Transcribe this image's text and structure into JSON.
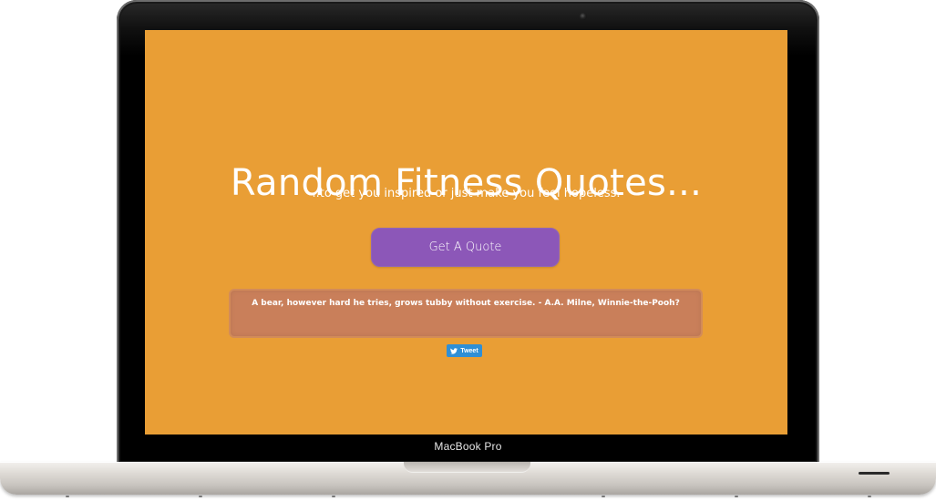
{
  "device": {
    "brand_label": "MacBook Pro"
  },
  "page": {
    "title": "Random Fitness Quotes...",
    "subtitle": "..to get you inspired or just make you feel hopeless.",
    "quote_button_label": "Get A Quote",
    "quote_text": "A bear, however hard he tries, grows tubby without exercise. - A.A. Milne, Winnie-the-Pooh?",
    "tweet_button_label": "Tweet"
  },
  "colors": {
    "background": "#e99e35",
    "button": "#8c57b8",
    "quote_box": "#c97f5a",
    "tweet": "#2f8fd6",
    "text": "#ffffff"
  },
  "icons": {
    "tweet": "twitter-bird-icon",
    "camera": "camera-icon"
  }
}
